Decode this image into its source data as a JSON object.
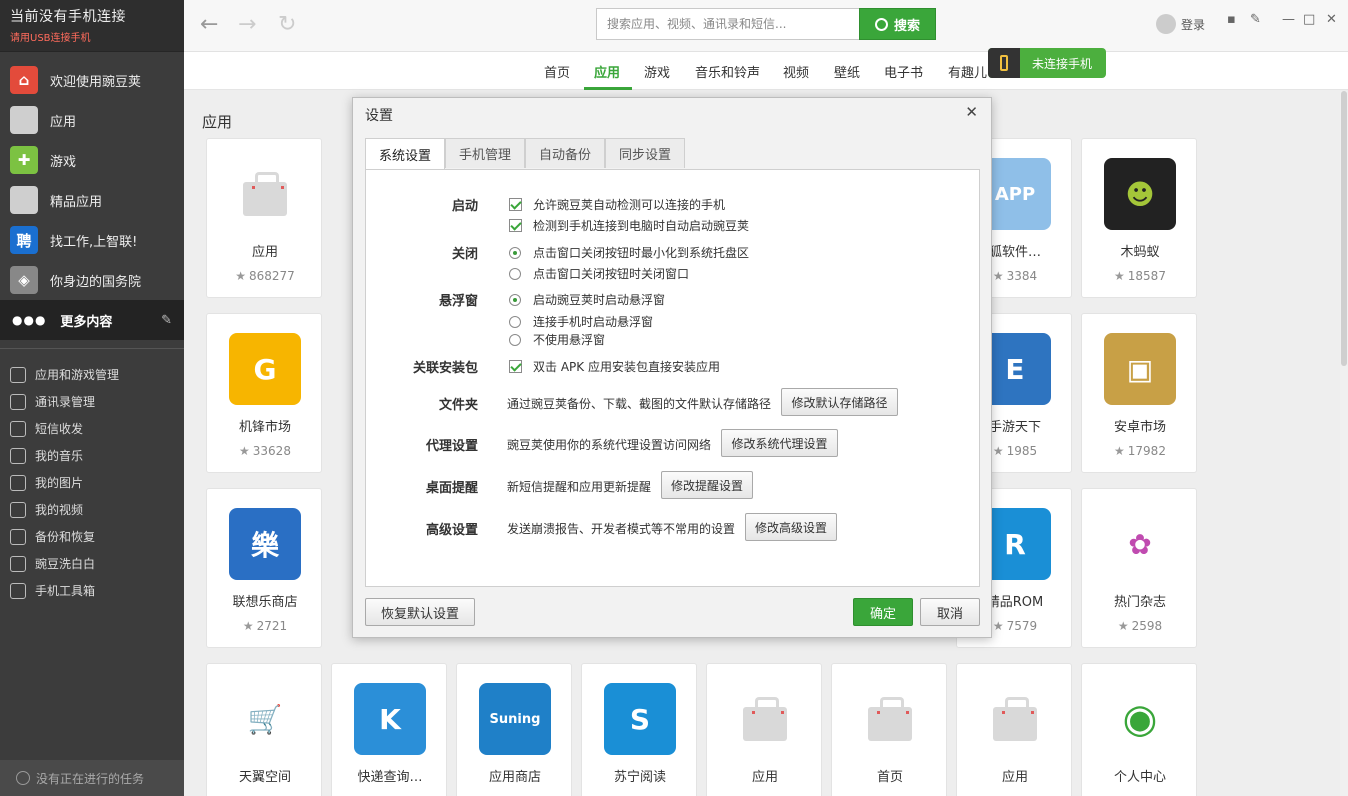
{
  "sidebar": {
    "title": "当前没有手机连接",
    "subtitle": "请用USB连接手机",
    "items": [
      {
        "label": "欢迎使用豌豆荚",
        "icon": "home-icon",
        "color": "#e34b3b"
      },
      {
        "label": "应用",
        "icon": "bag-icon",
        "color": "#cfcfcf"
      },
      {
        "label": "游戏",
        "icon": "gamepad-icon",
        "color": "#7cc242"
      },
      {
        "label": "精品应用",
        "icon": "bag-icon",
        "color": "#cfcfcf"
      },
      {
        "label": "找工作,上智联!",
        "icon": "zhaopin-icon",
        "color": "#1a6fd0"
      },
      {
        "label": "你身边的国务院",
        "icon": "gov-icon",
        "color": "#888888"
      }
    ],
    "more": "更多内容",
    "tools": [
      "应用和游戏管理",
      "通讯录管理",
      "短信收发",
      "我的音乐",
      "我的图片",
      "我的视频",
      "备份和恢复",
      "豌豆洗白白",
      "手机工具箱"
    ],
    "footer": "没有正在进行的任务"
  },
  "topbar": {
    "search_placeholder": "搜索应用、视频、通讯录和短信...",
    "search_button": "搜索",
    "login": "登录",
    "connect_pill": "未连接手机"
  },
  "navtabs": [
    "首页",
    "应用",
    "游戏",
    "音乐和铃声",
    "视频",
    "壁纸",
    "电子书",
    "有趣儿"
  ],
  "active_tab": "应用",
  "content": {
    "title": "应用",
    "cards": [
      {
        "name": "应用",
        "rating": "868277",
        "icon": "bag-icon"
      },
      {
        "name": "狐软件…",
        "rating": "3384",
        "icon": "app-icon"
      },
      {
        "name": "木蚂蚁",
        "rating": "18587",
        "icon": "android-icon"
      },
      {
        "name": "机锋市场",
        "rating": "33628",
        "icon": "gfan-icon"
      },
      {
        "name": "手游天下",
        "rating": "1985",
        "icon": "shouyou-icon"
      },
      {
        "name": "安卓市场",
        "rating": "17982",
        "icon": "box-icon"
      },
      {
        "name": "联想乐商店",
        "rating": "2721",
        "icon": "lenovo-icon"
      },
      {
        "name": "精品ROM",
        "rating": "7579",
        "icon": "rom-icon"
      },
      {
        "name": "热门杂志",
        "rating": "2598",
        "icon": "magazine-icon"
      },
      {
        "name": "天翼空间",
        "rating": "",
        "icon": "cart-icon"
      },
      {
        "name": "快递查询…",
        "rating": "",
        "icon": "kuaidi-icon"
      },
      {
        "name": "应用商店",
        "rating": "",
        "icon": "suning-icon"
      },
      {
        "name": "苏宁阅读",
        "rating": "",
        "icon": "book-icon"
      },
      {
        "name": "应用",
        "rating": "",
        "icon": "bag-icon"
      },
      {
        "name": "首页",
        "rating": "",
        "icon": "bag-icon"
      },
      {
        "name": "应用",
        "rating": "",
        "icon": "bag-icon"
      },
      {
        "name": "个人中心",
        "rating": "",
        "icon": "person-icon"
      }
    ]
  },
  "dialog": {
    "title": "设置",
    "tabs": [
      "系统设置",
      "手机管理",
      "自动备份",
      "同步设置"
    ],
    "sections": {
      "startup": {
        "label": "启动",
        "opt1": "允许豌豆荚自动检测可以连接的手机",
        "opt2": "检测到手机连接到电脑时自动启动豌豆荚"
      },
      "close": {
        "label": "关闭",
        "opt1": "点击窗口关闭按钮时最小化到系统托盘区",
        "opt2": "点击窗口关闭按钮时关闭窗口"
      },
      "float": {
        "label": "悬浮窗",
        "opt1": "启动豌豆荚时启动悬浮窗",
        "opt2": "连接手机时启动悬浮窗",
        "opt3": "不使用悬浮窗"
      },
      "apk": {
        "label": "关联安装包",
        "opt1": "双击 APK 应用安装包直接安装应用"
      },
      "folder": {
        "label": "文件夹",
        "desc": "通过豌豆荚备份、下载、截图的文件默认存储路径",
        "button": "修改默认存储路径"
      },
      "proxy": {
        "label": "代理设置",
        "desc": "豌豆荚使用你的系统代理设置访问网络",
        "button": "修改系统代理设置"
      },
      "notify": {
        "label": "桌面提醒",
        "desc": "新短信提醒和应用更新提醒",
        "button": "修改提醒设置"
      },
      "advanced": {
        "label": "高级设置",
        "desc": "发送崩溃报告、开发者模式等不常用的设置",
        "button": "修改高级设置"
      }
    },
    "reset": "恢复默认设置",
    "ok": "确定",
    "cancel": "取消"
  }
}
